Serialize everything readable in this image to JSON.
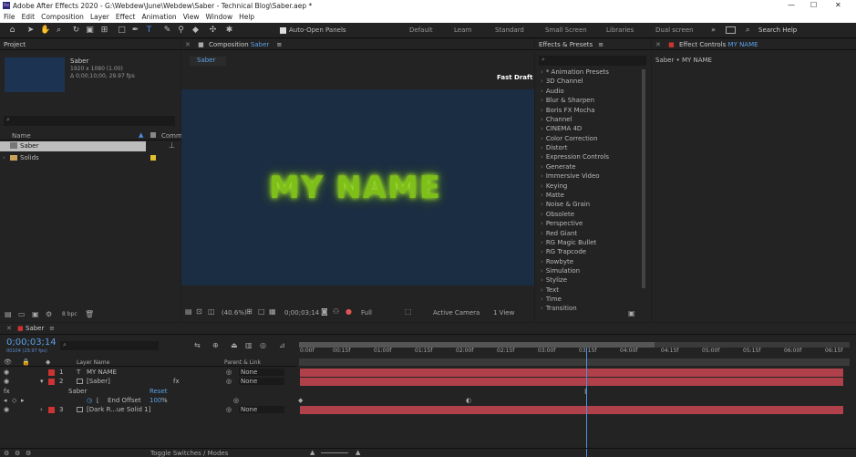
{
  "window": {
    "title": "Adobe After Effects 2020 - G:\\Webdew\\June\\Webdew\\Saber - Technical Blog\\Saber.aep *"
  },
  "menu": [
    "File",
    "Edit",
    "Composition",
    "Layer",
    "Effect",
    "Animation",
    "View",
    "Window",
    "Help"
  ],
  "toolbar": {
    "auto_open": "Auto-Open Panels",
    "workspaces": [
      "Default",
      "Learn",
      "Standard",
      "Small Screen",
      "Libraries",
      "Dual screen"
    ],
    "search": "Search Help"
  },
  "project": {
    "title": "Project",
    "item_name": "Saber",
    "item_dims": "1920 x 1080 (1.00)",
    "item_dur": "Δ 0;00;10;00, 29.97 fps",
    "col_name": "Name",
    "col_comment": "Comm",
    "items": [
      "Saber",
      "Solids"
    ],
    "bpc": "8 bpc"
  },
  "comp": {
    "title": "Composition",
    "name": "Saber",
    "tab": "Saber",
    "draft": "Fast Draft",
    "text": "MY NAME",
    "zoom": "(40.6%)",
    "time": "0;00;03;14",
    "res": "Full",
    "camera": "Active Camera",
    "view": "1 View"
  },
  "effects": {
    "title": "Effects & Presets",
    "items": [
      "* Animation Presets",
      "3D Channel",
      "Audio",
      "Blur & Sharpen",
      "Boris FX Mocha",
      "Channel",
      "CINEMA 4D",
      "Color Correction",
      "Distort",
      "Expression Controls",
      "Generate",
      "Immersive Video",
      "Keying",
      "Matte",
      "Noise & Grain",
      "Obsolete",
      "Perspective",
      "Red Giant",
      "RG Magic Bullet",
      "RG Trapcode",
      "Rowbyte",
      "Simulation",
      "Stylize",
      "Text",
      "Time",
      "Transition"
    ]
  },
  "effect_controls": {
    "title": "Effect Controls",
    "layer": "MY NAME",
    "sub": "Saber • MY NAME"
  },
  "timeline": {
    "tab": "Saber",
    "time": "0;00;03;14",
    "fps": "00104 (29.97 fps)",
    "col_layer": "Layer Name",
    "col_parent": "Parent & Link",
    "layers": [
      {
        "num": "1",
        "name": "MY NAME",
        "parent": "None"
      },
      {
        "num": "2",
        "name": "[Saber]",
        "parent": "None"
      },
      {
        "num": "3",
        "name": "[Dark R...ue Solid 1]",
        "parent": "None"
      }
    ],
    "fx": "Saber",
    "reset": "Reset",
    "prop": "End Offset",
    "prop_val": "100",
    "prop_unit": "%",
    "ruler": [
      "0:00f",
      "00:15f",
      "01:00f",
      "01:15f",
      "02:00f",
      "02:15f",
      "03:00f",
      "03:15f",
      "04:00f",
      "04:15f",
      "05:00f",
      "05:15f",
      "06:00f",
      "06:15f"
    ],
    "toggle": "Toggle Switches / Modes"
  }
}
